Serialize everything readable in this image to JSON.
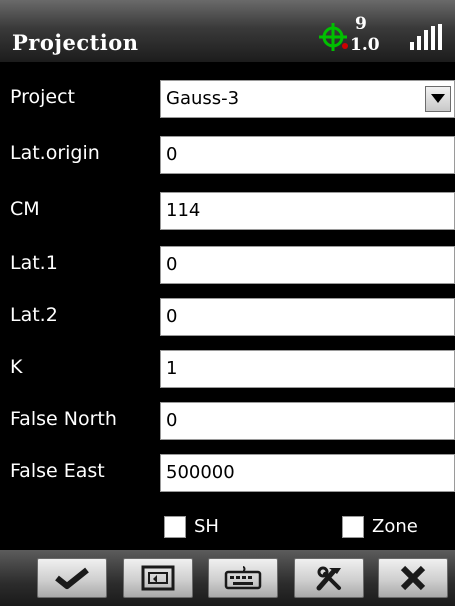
{
  "window": {
    "title": "Projection"
  },
  "status": {
    "satellites": "9",
    "pdop": "1.0"
  },
  "form": {
    "project": {
      "label": "Project",
      "value": "Gauss-3"
    },
    "lat_origin": {
      "label": "Lat.origin",
      "value": "0"
    },
    "cm": {
      "label": "CM",
      "value": "114"
    },
    "lat1": {
      "label": "Lat.1",
      "value": "0"
    },
    "lat2": {
      "label": "Lat.2",
      "value": "0"
    },
    "k": {
      "label": "K",
      "value": "1"
    },
    "false_north": {
      "label": "False North",
      "value": "0"
    },
    "false_east": {
      "label": "False East",
      "value": "500000"
    }
  },
  "options": {
    "sh": {
      "label": "SH",
      "checked": false
    },
    "zone": {
      "label": "Zone",
      "checked": false
    }
  },
  "toolbar": {
    "buttons": [
      {
        "icon": "checkmark-icon"
      },
      {
        "icon": "screen-icon"
      },
      {
        "icon": "keyboard-icon"
      },
      {
        "icon": "tools-icon"
      },
      {
        "icon": "close-icon"
      }
    ]
  },
  "colors": {
    "gps_icon": "#00c000",
    "gps_accent": "#d00000"
  }
}
